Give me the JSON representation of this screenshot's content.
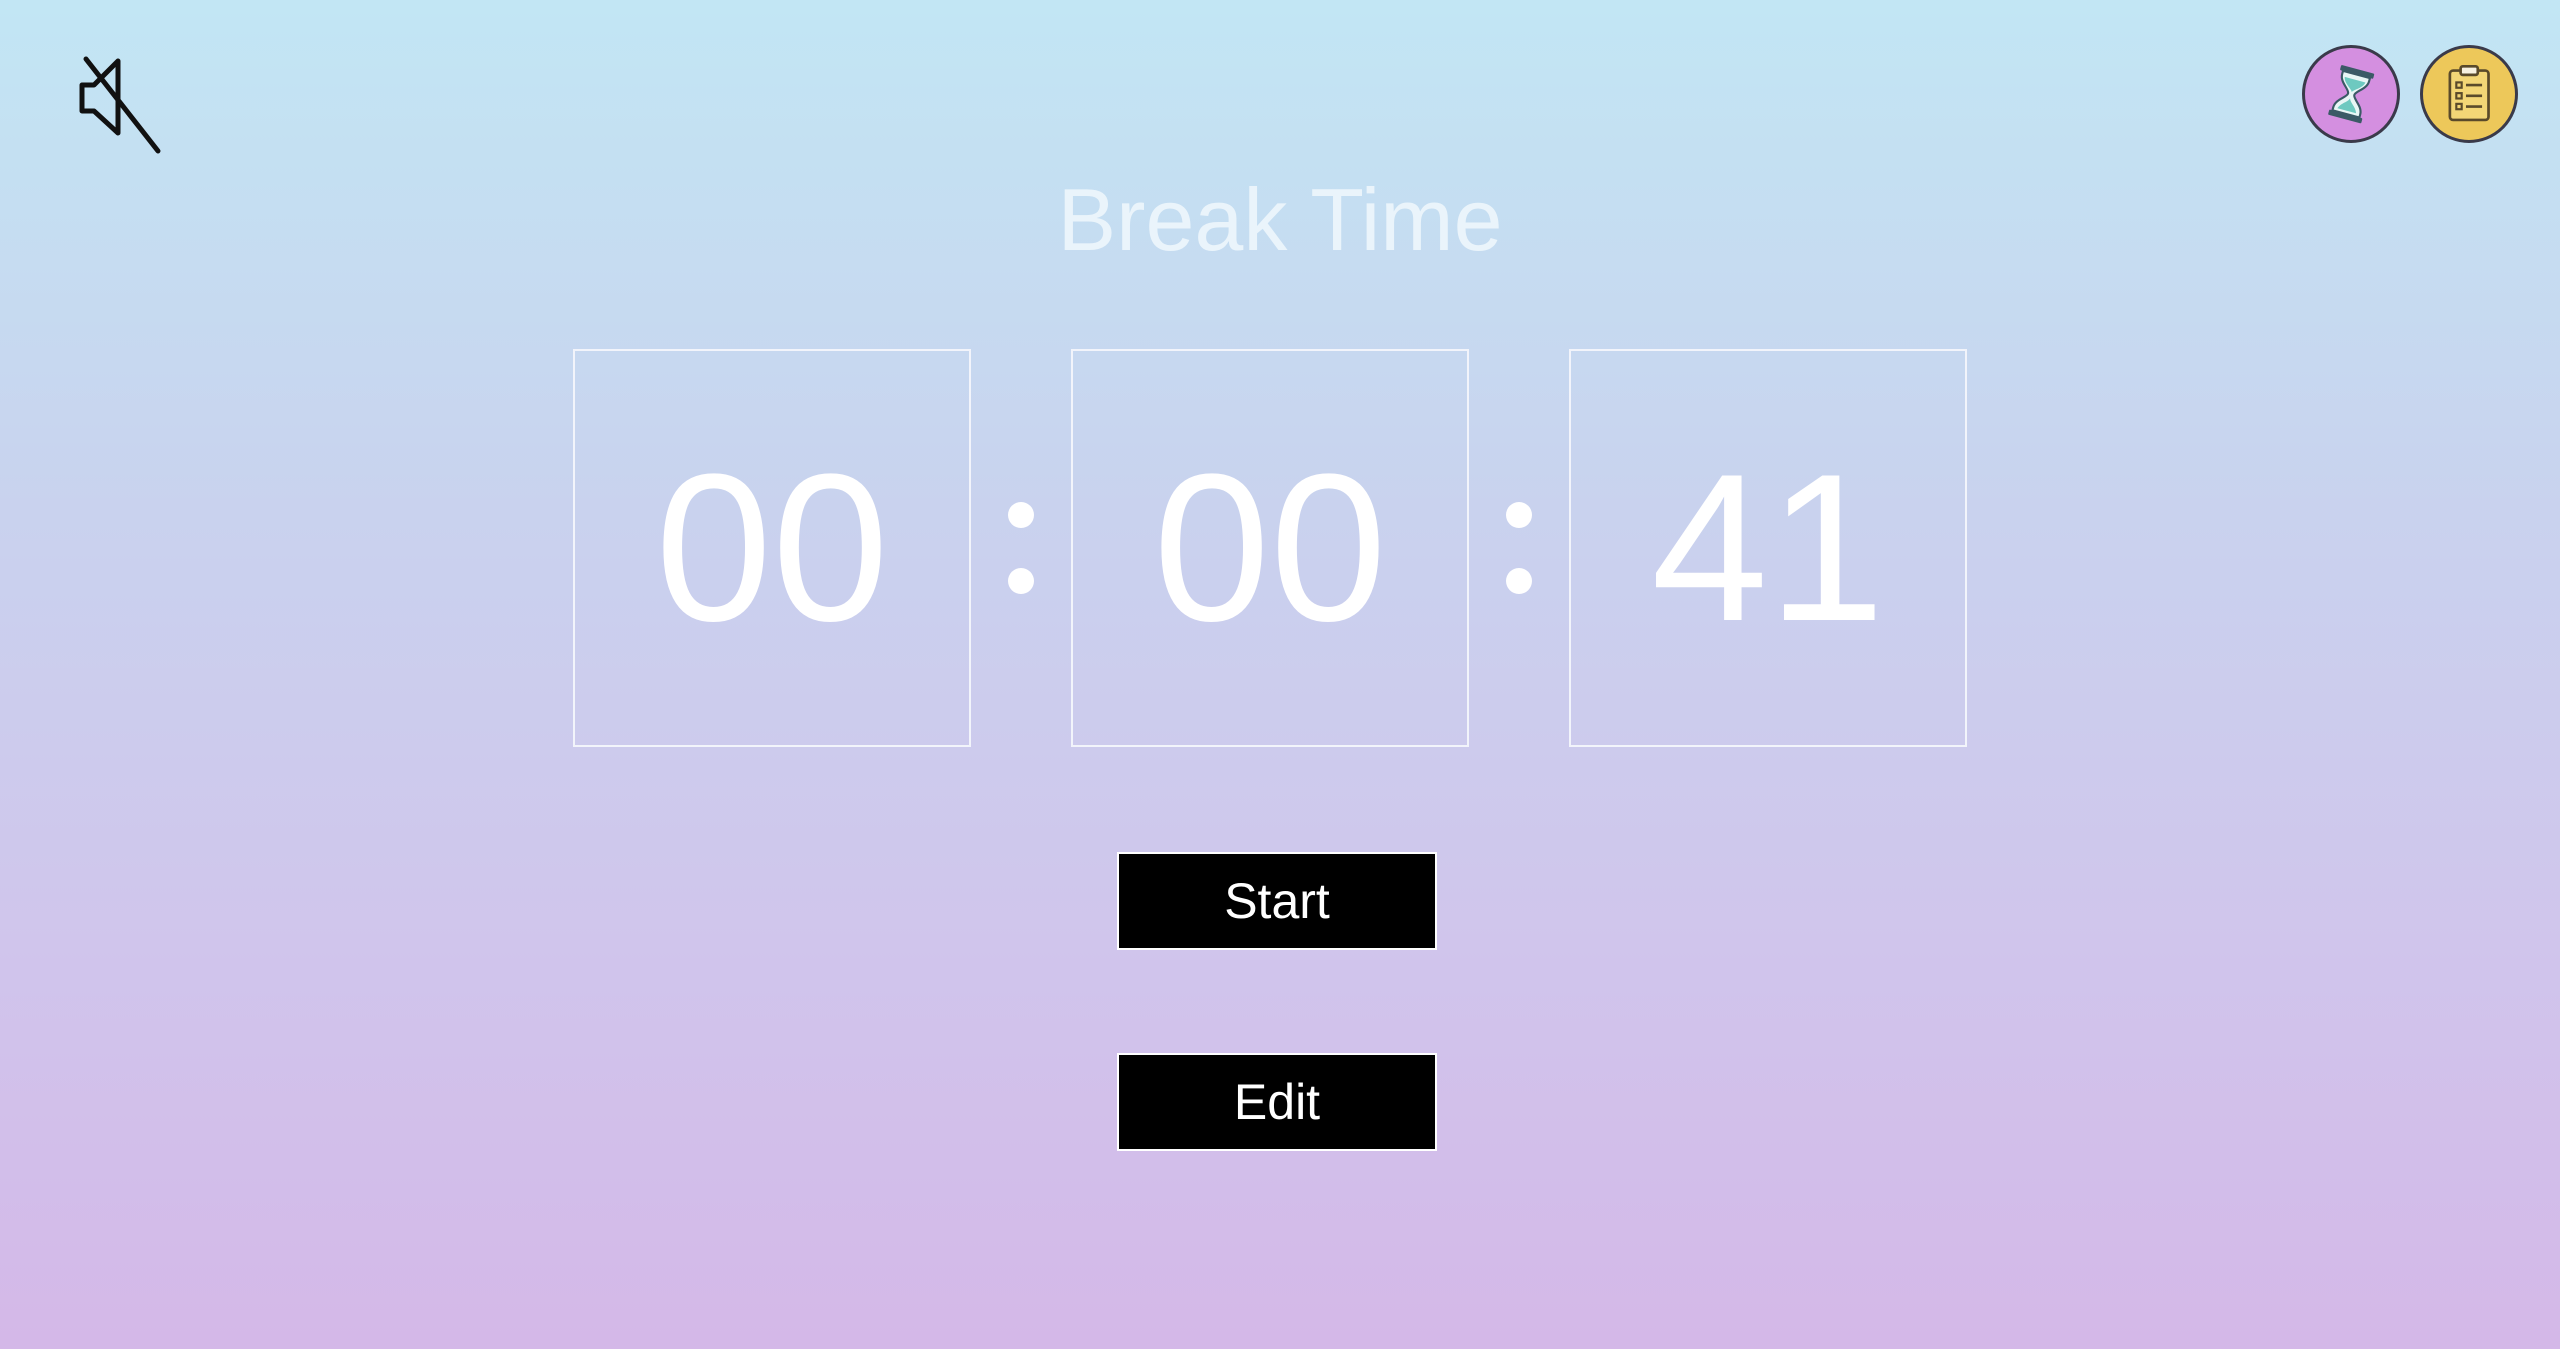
{
  "colors": {
    "background_top": "#c2e6f4",
    "background_bottom": "#d4b8e8",
    "hourglass_button": "#d48fe0",
    "tasks_button": "#edc85a",
    "button_bg": "#000000",
    "digits": "#ffffff"
  },
  "icons": {
    "mute": "speaker-muted-icon",
    "hourglass": "hourglass-icon",
    "tasks": "clipboard-checklist-icon"
  },
  "title": "Break Time",
  "timer": {
    "hours": "00",
    "minutes": "00",
    "seconds": "41"
  },
  "buttons": {
    "start_label": "Start",
    "edit_label": "Edit"
  }
}
